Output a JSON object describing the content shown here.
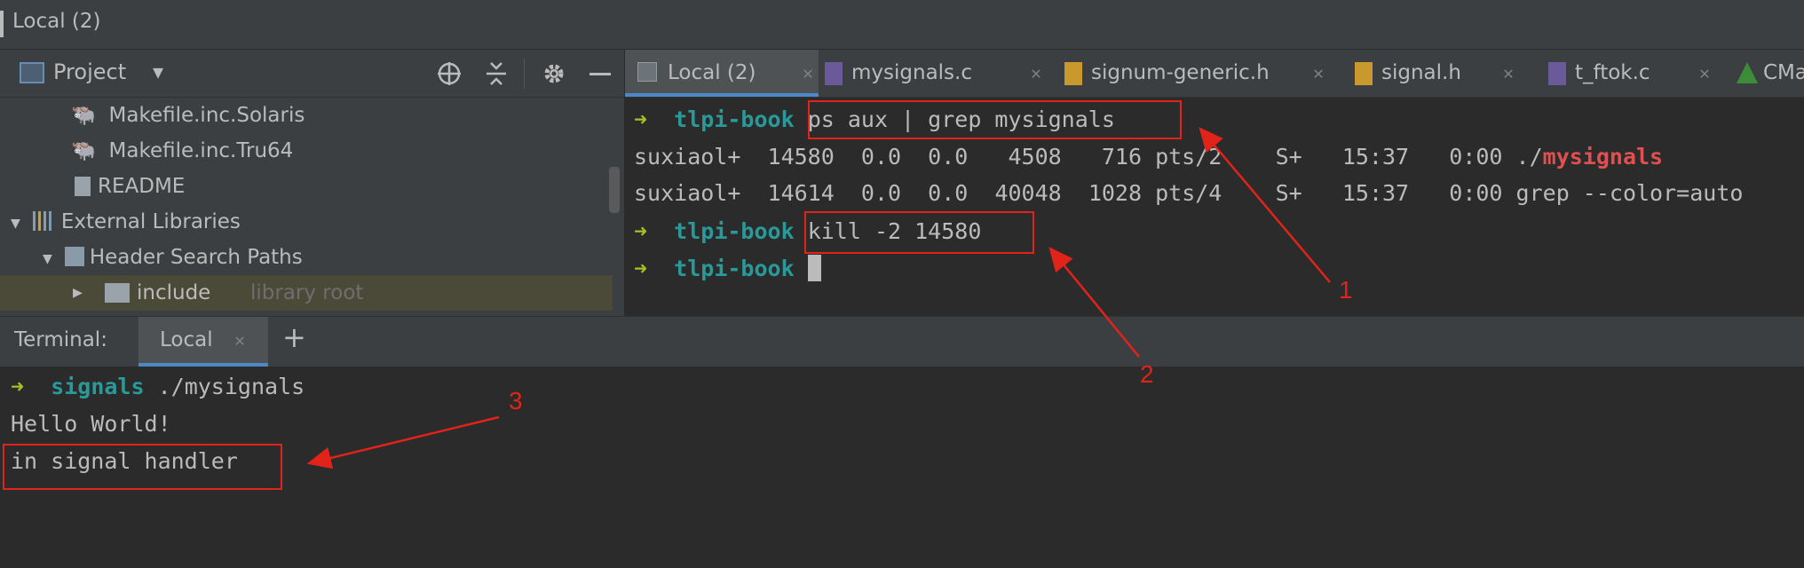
{
  "window": {
    "title": "Local (2)"
  },
  "project_panel": {
    "label": "Project",
    "tree": [
      {
        "label": "Makefile.inc.Solaris",
        "icon": "makefile-icon"
      },
      {
        "label": "Makefile.inc.Tru64",
        "icon": "makefile-icon"
      },
      {
        "label": "README",
        "icon": "text-file-icon"
      },
      {
        "label": "External Libraries",
        "icon": "library-icon"
      },
      {
        "label": "Header Search Paths",
        "icon": "header-paths-icon"
      },
      {
        "label": "include",
        "hint": "library root",
        "icon": "folder-icon"
      }
    ]
  },
  "editor_tabs": [
    {
      "label": "Local (2)",
      "icon": "terminal-icon",
      "active": true
    },
    {
      "label": "mysignals.c",
      "icon": "c-file-icon"
    },
    {
      "label": "signum-generic.h",
      "icon": "h-file-icon"
    },
    {
      "label": "signal.h",
      "icon": "h-file-icon"
    },
    {
      "label": "t_ftok.c",
      "icon": "c-file-icon"
    },
    {
      "label": "CMa",
      "icon": "cmake-icon"
    }
  ],
  "top_terminal": {
    "prompt_arrow": "➜",
    "dir": "tlpi-book",
    "cmd1": "ps aux | grep mysignals",
    "ps_line1": {
      "user": "suxiaol+",
      "pid": "14580",
      "cpu": "0.0",
      "mem": "0.0",
      "vsz": "4508",
      "rss": "716",
      "tty": "pts/2",
      "stat": "S+",
      "start": "15:37",
      "time": "0:00",
      "cmd_prefix": "./",
      "cmd_highlight": "mysignals"
    },
    "ps_line2": {
      "user": "suxiaol+",
      "pid": "14614",
      "cpu": "0.0",
      "mem": "0.0",
      "vsz": "40048",
      "rss": "1028",
      "tty": "pts/4",
      "stat": "S+",
      "start": "15:37",
      "time": "0:00",
      "cmd": "grep --color=auto"
    },
    "cmd2": "kill -2 14580"
  },
  "terminal_bar": {
    "label": "Terminal:",
    "tab": "Local",
    "add": "+"
  },
  "bottom_terminal": {
    "prompt_arrow": "➜",
    "dir": "signals",
    "cmd": "./mysignals",
    "out1": "Hello World!",
    "out2": "in signal handler"
  },
  "annotations": {
    "n1": "1",
    "n2": "2",
    "n3": "3"
  },
  "colors": {
    "annotation": "#e2231a",
    "prompt_dir": "#299999",
    "prompt_arrow": "#a8c023",
    "grep_match": "#e05050"
  }
}
